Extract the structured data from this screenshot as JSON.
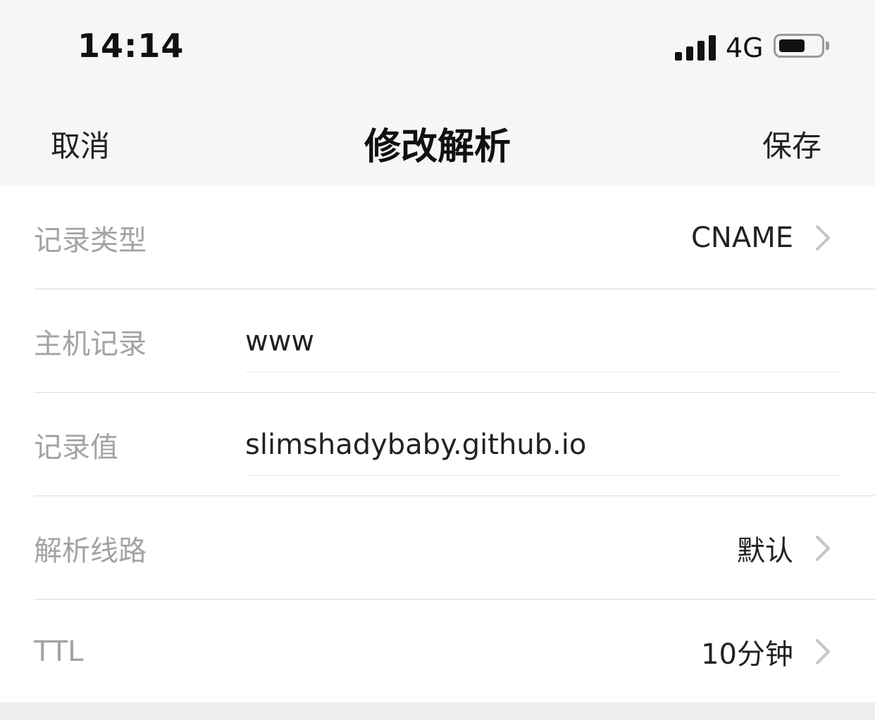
{
  "status_bar": {
    "time": "14:14",
    "network": "4G",
    "signal_icon": "cellular-signal-icon",
    "battery_icon": "battery-icon"
  },
  "nav": {
    "cancel_label": "取消",
    "title": "修改解析",
    "save_label": "保存"
  },
  "form": {
    "record_type": {
      "label": "记录类型",
      "value": "CNAME"
    },
    "host_record": {
      "label": "主机记录",
      "value": "www"
    },
    "record_value": {
      "label": "记录值",
      "value": "slimshadybaby.github.io"
    },
    "resolution_line": {
      "label": "解析线路",
      "value": "默认"
    },
    "ttl": {
      "label": "TTL",
      "value": "10分钟"
    }
  },
  "colors": {
    "background": "#f7f5f6",
    "card": "#ffffff",
    "label": "#a3a3a3",
    "text": "#222222",
    "divider": "#dcdcdc"
  }
}
